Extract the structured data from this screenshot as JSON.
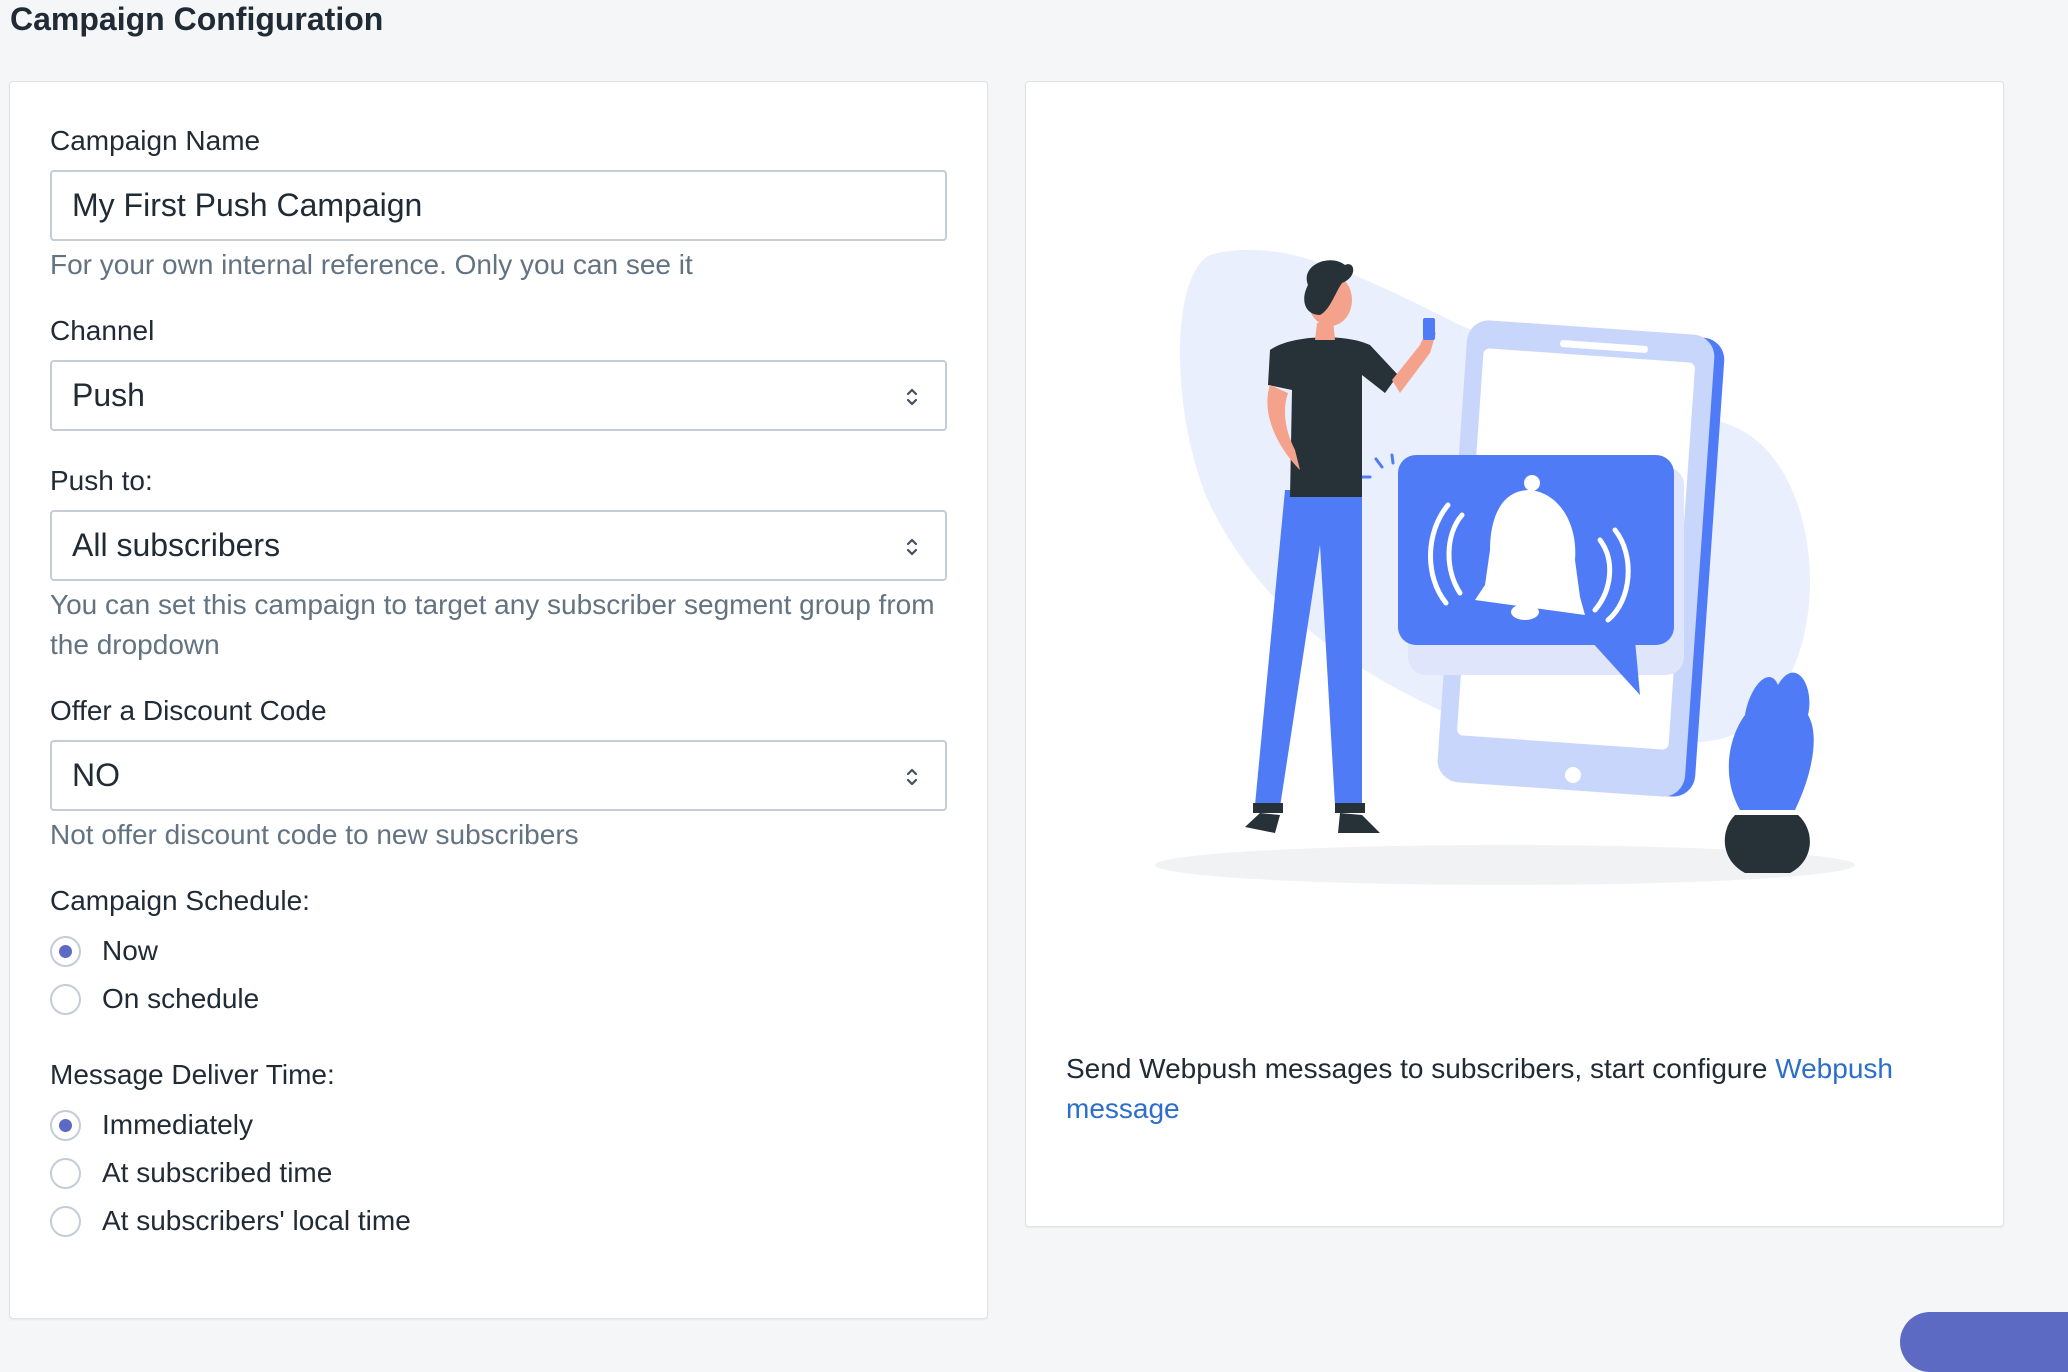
{
  "page": {
    "title": "Campaign Configuration"
  },
  "form": {
    "campaign_name": {
      "label": "Campaign Name",
      "value": "My First Push Campaign",
      "help": "For your own internal reference. Only you can see it"
    },
    "channel": {
      "label": "Channel",
      "selected": "Push"
    },
    "push_to": {
      "label": "Push to:",
      "selected": "All subscribers",
      "help": "You can set this campaign to target any subscriber segment group from the dropdown"
    },
    "discount": {
      "label": "Offer a Discount Code",
      "selected": "NO",
      "help": "Not offer discount code to new subscribers"
    },
    "schedule": {
      "label": "Campaign Schedule:",
      "options": [
        {
          "label": "Now",
          "checked": true
        },
        {
          "label": "On schedule",
          "checked": false
        }
      ]
    },
    "deliver_time": {
      "label": "Message Deliver Time:",
      "options": [
        {
          "label": "Immediately",
          "checked": true
        },
        {
          "label": "At subscribed time",
          "checked": false
        },
        {
          "label": "At subscribers' local time",
          "checked": false
        }
      ]
    }
  },
  "promo": {
    "text": "Send Webpush messages to subscribers, start configure ",
    "link_label": "Webpush message",
    "illustration_icon": "person-phone-bell-illustration"
  },
  "colors": {
    "accent": "#5c6ac4",
    "link": "#2c6ecb",
    "illustration_blue": "#4f7cf6"
  }
}
